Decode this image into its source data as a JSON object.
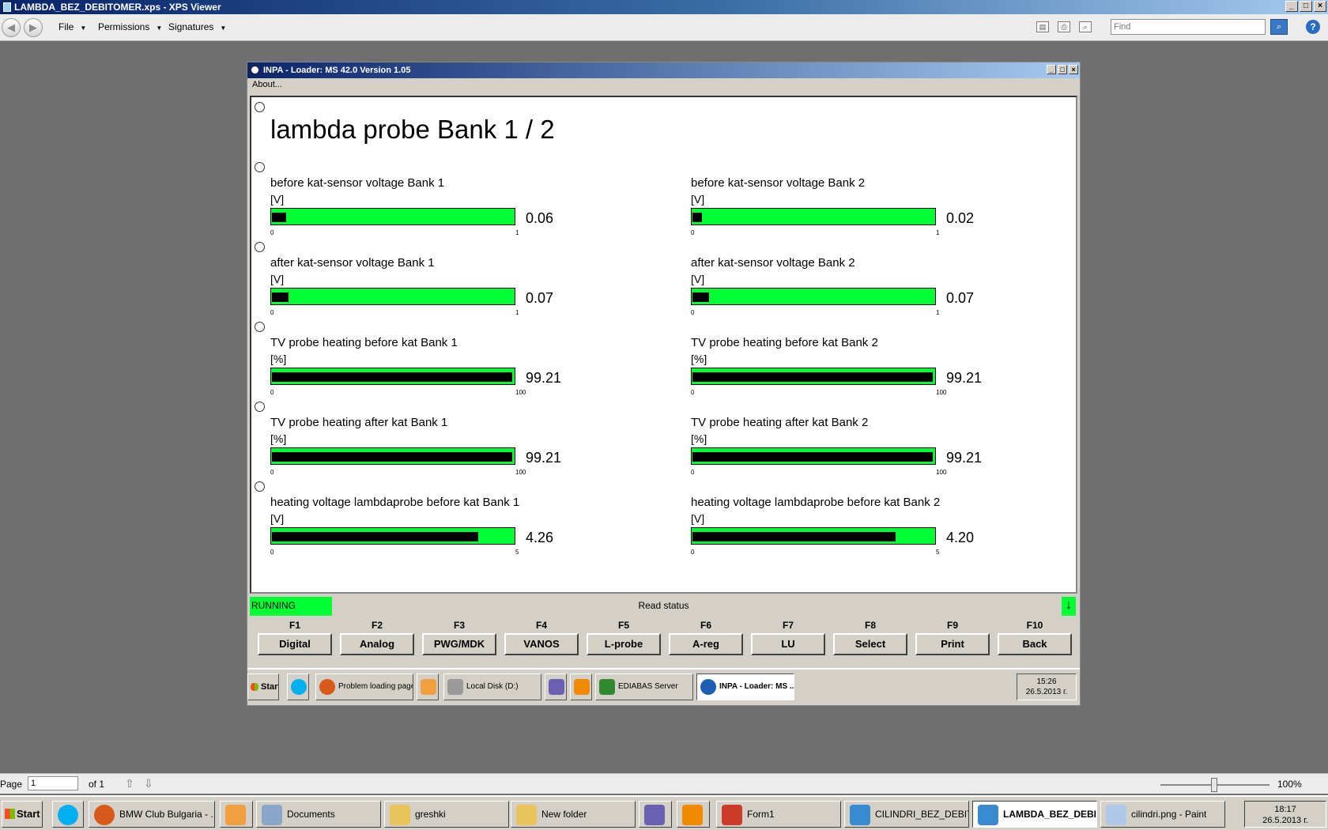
{
  "xps": {
    "title": "LAMBDA_BEZ_DEBITOMER.xps - XPS Viewer",
    "menus": [
      "File",
      "Permissions",
      "Signatures"
    ],
    "find_placeholder": "Find",
    "page_label": "Page",
    "page_value": "1",
    "page_of": "of 1",
    "zoom": "100%"
  },
  "inpa": {
    "title": "INPA - Loader:  MS 42.0 Version 1.05",
    "menu_about": "About...",
    "heading": "lambda probe Bank 1 / 2",
    "gauges": [
      {
        "label": "before kat-sensor voltage Bank 1",
        "unit": "[V]",
        "value": "0.06",
        "min": "0",
        "max": "1",
        "fraction": 0.06
      },
      {
        "label": "before kat-sensor voltage Bank 2",
        "unit": "[V]",
        "value": "0.02",
        "min": "0",
        "max": "1",
        "fraction": 0.02
      },
      {
        "label": "after kat-sensor voltage Bank 1",
        "unit": "[V]",
        "value": "0.07",
        "min": "0",
        "max": "1",
        "fraction": 0.07
      },
      {
        "label": "after kat-sensor voltage Bank 2",
        "unit": "[V]",
        "value": "0.07",
        "min": "0",
        "max": "1",
        "fraction": 0.07
      },
      {
        "label": "TV probe heating before kat Bank 1",
        "unit": "[%]",
        "value": "99.21",
        "min": "0",
        "max": "100",
        "fraction": 0.9921
      },
      {
        "label": "TV probe heating before kat Bank 2",
        "unit": "[%]",
        "value": "99.21",
        "min": "0",
        "max": "100",
        "fraction": 0.9921
      },
      {
        "label": "TV probe heating after kat Bank 1",
        "unit": "[%]",
        "value": "99.21",
        "min": "0",
        "max": "100",
        "fraction": 0.9921
      },
      {
        "label": "TV probe heating after kat Bank 2",
        "unit": "[%]",
        "value": "99.21",
        "min": "0",
        "max": "100",
        "fraction": 0.9921
      },
      {
        "label": "heating voltage lambdaprobe before kat Bank 1",
        "unit": "[V]",
        "value": "4.26",
        "min": "0",
        "max": "5",
        "fraction": 0.852
      },
      {
        "label": "heating voltage lambdaprobe before kat Bank 2",
        "unit": "[V]",
        "value": "4.20",
        "min": "0",
        "max": "5",
        "fraction": 0.84
      }
    ],
    "status_running": "RUNNING",
    "status_text": "Read status",
    "fkeys": [
      {
        "key": "F1",
        "label": "Digital"
      },
      {
        "key": "F2",
        "label": "Analog"
      },
      {
        "key": "F3",
        "label": "PWG/MDK"
      },
      {
        "key": "F4",
        "label": "VANOS"
      },
      {
        "key": "F5",
        "label": "L-probe"
      },
      {
        "key": "F6",
        "label": "A-reg"
      },
      {
        "key": "F7",
        "label": "LU"
      },
      {
        "key": "F8",
        "label": "Select"
      },
      {
        "key": "F9",
        "label": "Print"
      },
      {
        "key": "F10",
        "label": "Back"
      }
    ]
  },
  "inner_taskbar": {
    "start": "Start",
    "items": [
      {
        "label": "Problem loading page...",
        "icon": "firefox-icon",
        "color": "#d85a1a"
      },
      {
        "label": "Local Disk (D:)",
        "icon": "drive-icon",
        "color": "#9a9a9a"
      },
      {
        "label": "EDIABAS Server",
        "icon": "ediabas-icon",
        "color": "#2f8a2f"
      },
      {
        "label": "INPA - Loader:  MS ...",
        "icon": "bmw-icon",
        "color": "#1e5fb3"
      }
    ],
    "time": "15:26",
    "date": "26.5.2013 г."
  },
  "taskbar": {
    "start": "Start",
    "items": [
      {
        "label": "BMW Club Bulgaria - ...",
        "icon": "firefox-icon",
        "color": "#d85a1a"
      },
      {
        "label": "Documents",
        "icon": "documents-icon",
        "color": "#8aa6c8"
      },
      {
        "label": "greshki",
        "icon": "folder-icon",
        "color": "#e8c45a"
      },
      {
        "label": "New folder",
        "icon": "folder-icon",
        "color": "#e8c45a"
      },
      {
        "label": "Form1",
        "icon": "form-icon",
        "color": "#cc3a2a"
      },
      {
        "label": "CILINDRI_BEZ_DEBIT...",
        "icon": "xps-icon",
        "color": "#3a8ad0"
      },
      {
        "label": "LAMBDA_BEZ_DEBI...",
        "icon": "xps-icon",
        "color": "#3a8ad0"
      },
      {
        "label": "cilindri.png - Paint",
        "icon": "paint-icon",
        "color": "#b0c8e8"
      }
    ],
    "time": "18:17",
    "date": "26.5.2013 г."
  }
}
